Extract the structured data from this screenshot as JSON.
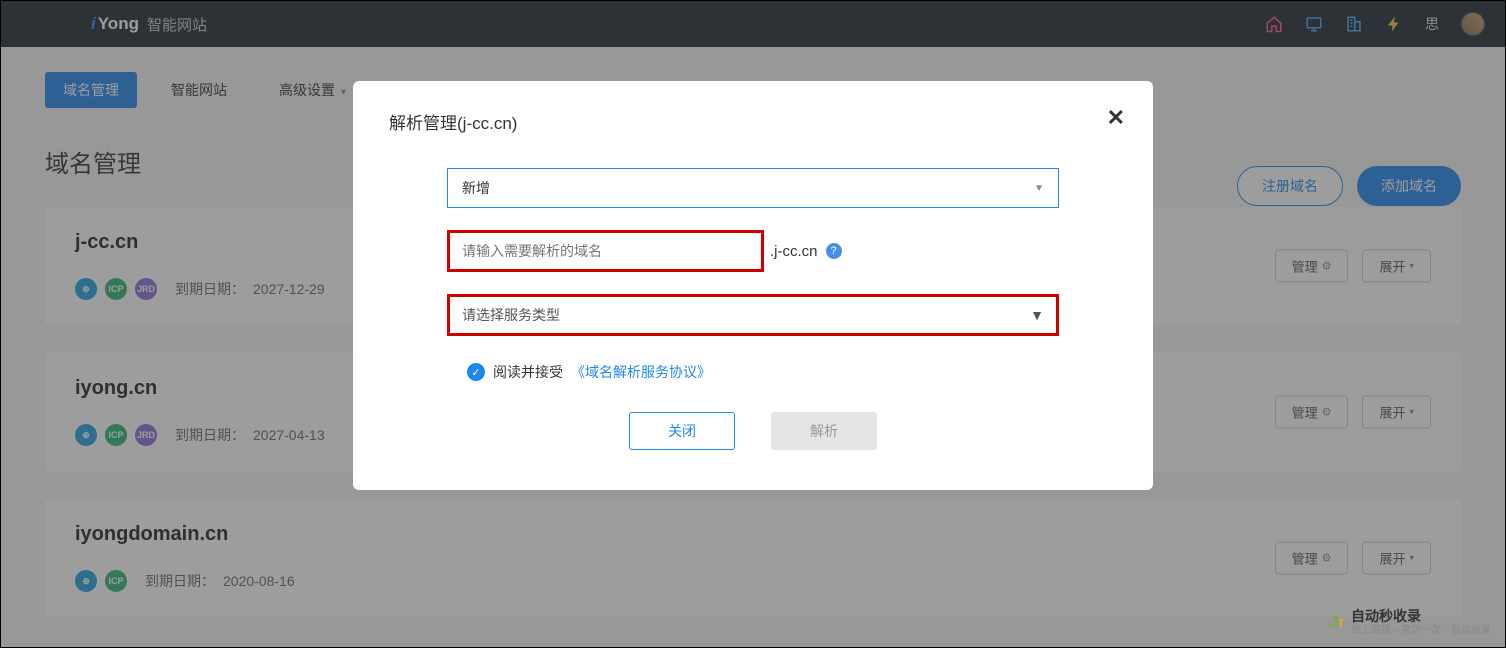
{
  "header": {
    "logo_i": "i",
    "logo_yong": "Yong",
    "logo_cn": "智能网站",
    "user_label": "思"
  },
  "tabs": {
    "domain_mgmt": "域名管理",
    "smart_site": "智能网站",
    "advanced": "高级设置"
  },
  "page": {
    "title": "域名管理",
    "register_btn": "注册域名",
    "add_btn": "添加域名"
  },
  "card_labels": {
    "expire": "到期日期：",
    "manage": "管理",
    "expand": "展开"
  },
  "domains": [
    {
      "name": "j-cc.cn",
      "expire": "2027-12-29",
      "has_jrd": true
    },
    {
      "name": "iyong.cn",
      "expire": "2027-04-13",
      "has_jrd": true
    },
    {
      "name": "iyongdomain.cn",
      "expire": "2020-08-16",
      "has_jrd": false
    }
  ],
  "modal": {
    "title": "解析管理(j-cc.cn)",
    "select1": "新增",
    "input_placeholder": "请输入需要解析的域名",
    "domain_suffix": ".j-cc.cn",
    "select2": "请选择服务类型",
    "agree_text": "阅读并接受",
    "agree_link": "《域名解析服务协议》",
    "close_btn": "关闭",
    "parse_btn": "解析"
  },
  "watermark": {
    "title": "自动秒收录",
    "sub": "做上链接→来访一次→自动收录"
  }
}
